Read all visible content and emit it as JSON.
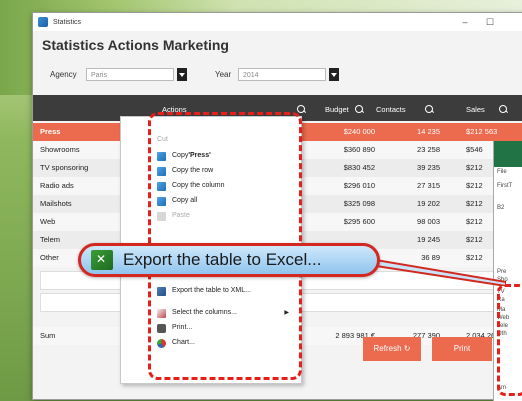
{
  "window": {
    "title": "Statistics",
    "minimize": "–",
    "maximize": "☐",
    "close": "✕"
  },
  "heading": "Statistics Actions Marketing",
  "filters": {
    "agency_label": "Agency",
    "agency_value": "Paris",
    "year_label": "Year",
    "year_value": "2014"
  },
  "table": {
    "headers": [
      "Actions",
      "Budget",
      "Contacts",
      "Sales"
    ],
    "rows": [
      {
        "name": "Press",
        "budget": "$240 000",
        "contacts": "14 235",
        "sales": "$212 563"
      },
      {
        "name": "Showrooms",
        "budget": "$360 890",
        "contacts": "23 258",
        "sales": "$546"
      },
      {
        "name": "TV sponsoring",
        "budget": "$830 452",
        "contacts": "39 235",
        "sales": "$212"
      },
      {
        "name": "Radio ads",
        "budget": "$296 010",
        "contacts": "27 315",
        "sales": "$212"
      },
      {
        "name": "Mailshots",
        "budget": "$325 098",
        "contacts": "19 202",
        "sales": "$212"
      },
      {
        "name": "Web",
        "budget": "$295 600",
        "contacts": "98 003",
        "sales": "$212"
      },
      {
        "name": "Telem",
        "budget": "",
        "contacts": "19 245",
        "sales": "$212"
      },
      {
        "name": "Other",
        "budget": "",
        "contacts": "36 89",
        "sales": "$212"
      }
    ],
    "sum": {
      "name": "Sum",
      "budget": "2 893 981 €",
      "contacts": "277 390",
      "sales": "2 034 26"
    }
  },
  "buttons": {
    "refresh": "Refresh",
    "print": "Print"
  },
  "context_menu": {
    "cut": "Cut",
    "copy_prefix": "Copy ",
    "copy_value": "'Press'",
    "copy_row": "Copy the row",
    "copy_column": "Copy the column",
    "copy_all": "Copy all",
    "paste": "Paste",
    "export_xml": "Export the table to XML...",
    "select_columns": "Select the columns...",
    "print": "Print...",
    "chart": "Chart...",
    "submenu_arrow": "▶"
  },
  "callout": {
    "text": "Export the table to Excel..."
  },
  "excel": {
    "file": "File",
    "first": "FirstT",
    "ref": "B2",
    "rows": [
      "Pre",
      "Sho",
      "TV",
      "Ra",
      "Ma",
      "Web",
      "Tele",
      "Oth",
      "Am"
    ]
  },
  "colors": {
    "accent": "#ec6b4e",
    "header": "#3c3c3c",
    "highlight": "#e5201c"
  }
}
